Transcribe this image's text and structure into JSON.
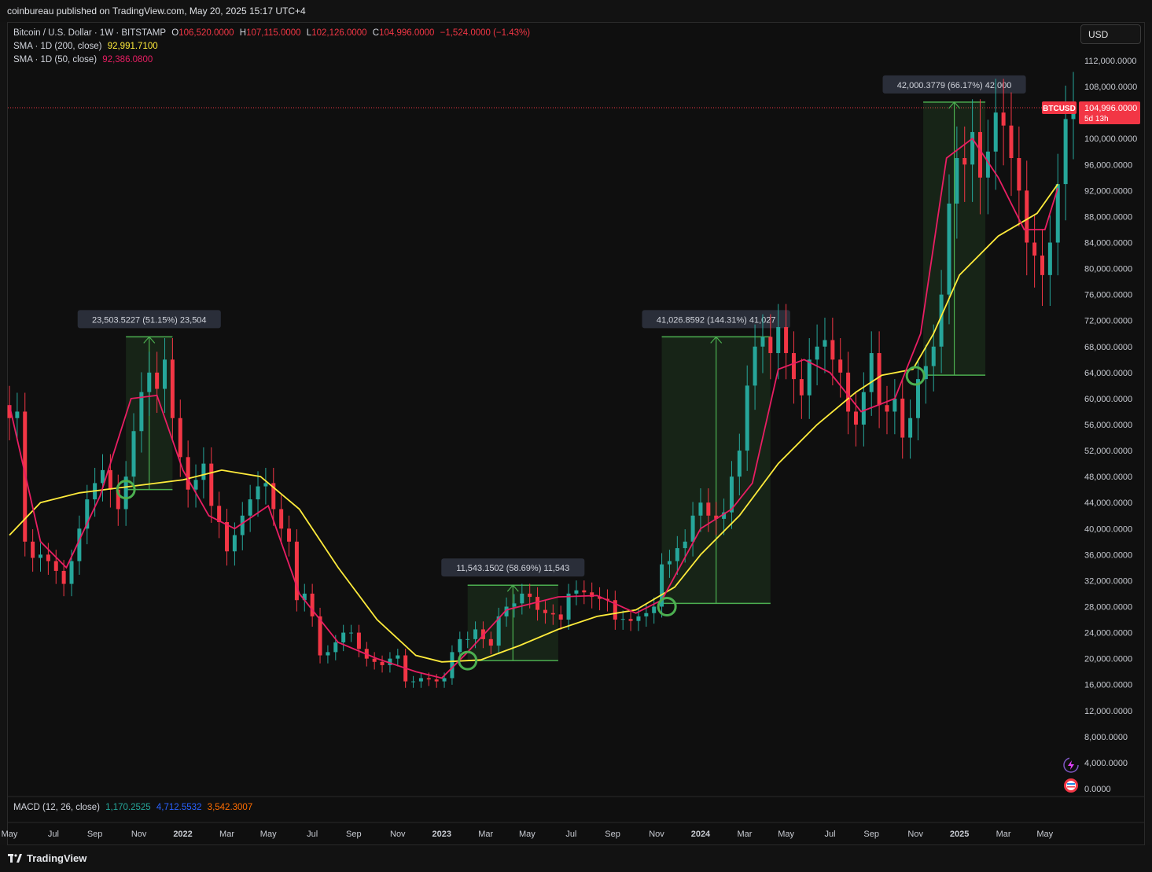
{
  "header": {
    "published": "coinbureau published on TradingView.com, May 20, 2025 15:17 UTC+4"
  },
  "legend": {
    "symbol": "Bitcoin / U.S. Dollar · 1W · BITSTAMP",
    "o_label": "O",
    "o_value": "106,520.0000",
    "h_label": "H",
    "h_value": "107,115.0000",
    "l_label": "L",
    "l_value": "102,126.0000",
    "c_label": "C",
    "c_value": "104,996.0000",
    "change": "−1,524.0000 (−1.43%)",
    "sma200_label": "SMA · 1D (200, close)",
    "sma200_value": "92,991.7100",
    "sma50_label": "SMA · 1D (50, close)",
    "sma50_value": "92,386.0800"
  },
  "macd": {
    "label": "MACD (12, 26, close)",
    "v1": "1,170.2525",
    "v2": "4,712.5532",
    "v3": "3,542.3007"
  },
  "currency_button": "USD",
  "price_tag": {
    "symbol": "BTCUSD",
    "price": "104,996.0000",
    "countdown": "5d 13h"
  },
  "footer": {
    "brand": "TradingView"
  },
  "colors": {
    "up": "#26a69a",
    "down": "#f23645",
    "sma200": "#ffeb3b",
    "sma50": "#e91e63",
    "range_box": "#4caf50",
    "circle": "#4caf50"
  },
  "chart_data": {
    "type": "candlestick",
    "interval": "1W",
    "y_axis_labels": [
      "112,000.0000",
      "108,000.0000",
      "100,000.0000",
      "96,000.0000",
      "92,000.0000",
      "88,000.0000",
      "84,000.0000",
      "80,000.0000",
      "76,000.0000",
      "72,000.0000",
      "68,000.0000",
      "64,000.0000",
      "60,000.0000",
      "56,000.0000",
      "52,000.0000",
      "48,000.0000",
      "44,000.0000",
      "40,000.0000",
      "36,000.0000",
      "32,000.0000",
      "28,000.0000",
      "24,000.0000",
      "20,000.0000",
      "16,000.0000",
      "12,000.0000",
      "8,000.0000",
      "4,000.0000",
      "0.0000"
    ],
    "x_axis_labels": [
      "May",
      "Jul",
      "Sep",
      "Nov",
      "2022",
      "Mar",
      "May",
      "Jul",
      "Sep",
      "Nov",
      "2023",
      "Mar",
      "May",
      "Jul",
      "Sep",
      "Nov",
      "2024",
      "Mar",
      "May",
      "Jul",
      "Sep",
      "Nov",
      "2025",
      "Mar",
      "May"
    ],
    "x_axis_bold": [
      "2022",
      "2023",
      "2024",
      "2025"
    ],
    "range_labels": [
      "23,503.5227 (51.15%) 23,504",
      "11,543.1502 (58.69%) 11,543",
      "41,026.8592 (144.31%) 41,027",
      "42,000.3779 (66.17%) 42,000"
    ],
    "ranges": [
      {
        "from": 46000,
        "to": 69500
      },
      {
        "from": 19700,
        "to": 31300
      },
      {
        "from": 28500,
        "to": 69500
      },
      {
        "from": 63600,
        "to": 105600
      }
    ],
    "sma200_line": [
      [
        2021.33,
        39000
      ],
      [
        2021.45,
        44000
      ],
      [
        2021.6,
        45500
      ],
      [
        2021.8,
        46500
      ],
      [
        2022.0,
        47500
      ],
      [
        2022.15,
        49000
      ],
      [
        2022.3,
        48000
      ],
      [
        2022.45,
        43000
      ],
      [
        2022.6,
        34000
      ],
      [
        2022.75,
        26000
      ],
      [
        2022.9,
        20500
      ],
      [
        2023.0,
        19500
      ],
      [
        2023.15,
        19800
      ],
      [
        2023.3,
        22000
      ],
      [
        2023.45,
        24500
      ],
      [
        2023.6,
        26500
      ],
      [
        2023.75,
        27500
      ],
      [
        2023.9,
        31000
      ],
      [
        2024.0,
        36000
      ],
      [
        2024.15,
        42000
      ],
      [
        2024.3,
        50000
      ],
      [
        2024.45,
        56000
      ],
      [
        2024.6,
        61000
      ],
      [
        2024.7,
        63600
      ],
      [
        2024.82,
        64500
      ],
      [
        2024.9,
        70000
      ],
      [
        2025.0,
        79000
      ],
      [
        2025.15,
        85000
      ],
      [
        2025.3,
        88500
      ],
      [
        2025.38,
        92990
      ]
    ],
    "sma50_line": [
      [
        2021.33,
        59000
      ],
      [
        2021.45,
        38000
      ],
      [
        2021.55,
        34000
      ],
      [
        2021.68,
        45000
      ],
      [
        2021.8,
        60000
      ],
      [
        2021.9,
        60500
      ],
      [
        2022.0,
        49000
      ],
      [
        2022.1,
        42000
      ],
      [
        2022.2,
        40000
      ],
      [
        2022.33,
        43500
      ],
      [
        2022.45,
        30000
      ],
      [
        2022.6,
        22500
      ],
      [
        2022.75,
        20000
      ],
      [
        2022.9,
        18000
      ],
      [
        2023.0,
        17000
      ],
      [
        2023.1,
        21000
      ],
      [
        2023.25,
        27500
      ],
      [
        2023.45,
        29500
      ],
      [
        2023.6,
        29700
      ],
      [
        2023.75,
        27000
      ],
      [
        2023.85,
        29000
      ],
      [
        2024.0,
        40000
      ],
      [
        2024.12,
        43000
      ],
      [
        2024.2,
        47000
      ],
      [
        2024.3,
        64500
      ],
      [
        2024.4,
        66000
      ],
      [
        2024.5,
        64000
      ],
      [
        2024.62,
        58000
      ],
      [
        2024.75,
        60000
      ],
      [
        2024.85,
        70000
      ],
      [
        2024.95,
        97000
      ],
      [
        2025.05,
        100000
      ],
      [
        2025.15,
        94000
      ],
      [
        2025.25,
        86000
      ],
      [
        2025.33,
        86000
      ],
      [
        2025.38,
        92380
      ]
    ],
    "closes": [
      [
        2021.33,
        57000
      ],
      [
        2021.36,
        58000
      ],
      [
        2021.39,
        38000
      ],
      [
        2021.42,
        35500
      ],
      [
        2021.45,
        36000
      ],
      [
        2021.48,
        35000
      ],
      [
        2021.51,
        33500
      ],
      [
        2021.54,
        31500
      ],
      [
        2021.57,
        35000
      ],
      [
        2021.6,
        40000
      ],
      [
        2021.63,
        44500
      ],
      [
        2021.66,
        47000
      ],
      [
        2021.69,
        49000
      ],
      [
        2021.72,
        46000
      ],
      [
        2021.75,
        43000
      ],
      [
        2021.78,
        48000
      ],
      [
        2021.81,
        55000
      ],
      [
        2021.84,
        61000
      ],
      [
        2021.87,
        64000
      ],
      [
        2021.9,
        61500
      ],
      [
        2021.93,
        66000
      ],
      [
        2021.96,
        57000
      ],
      [
        2021.99,
        51000
      ],
      [
        2022.02,
        46000
      ],
      [
        2022.05,
        47500
      ],
      [
        2022.08,
        50000
      ],
      [
        2022.11,
        43500
      ],
      [
        2022.14,
        41000
      ],
      [
        2022.17,
        36500
      ],
      [
        2022.2,
        39000
      ],
      [
        2022.23,
        42000
      ],
      [
        2022.26,
        44500
      ],
      [
        2022.29,
        46500
      ],
      [
        2022.32,
        47000
      ],
      [
        2022.35,
        43000
      ],
      [
        2022.38,
        40000
      ],
      [
        2022.41,
        38000
      ],
      [
        2022.44,
        29000
      ],
      [
        2022.47,
        30000
      ],
      [
        2022.5,
        26500
      ],
      [
        2022.53,
        20500
      ],
      [
        2022.56,
        21000
      ],
      [
        2022.59,
        22500
      ],
      [
        2022.62,
        24000
      ],
      [
        2022.65,
        24000
      ],
      [
        2022.68,
        21500
      ],
      [
        2022.71,
        20000
      ],
      [
        2022.74,
        19500
      ],
      [
        2022.77,
        19000
      ],
      [
        2022.8,
        20000
      ],
      [
        2022.83,
        20500
      ],
      [
        2022.86,
        16500
      ],
      [
        2022.89,
        16500
      ],
      [
        2022.92,
        17000
      ],
      [
        2022.95,
        16800
      ],
      [
        2022.98,
        16500
      ],
      [
        2023.01,
        17000
      ],
      [
        2023.04,
        21000
      ],
      [
        2023.07,
        23000
      ],
      [
        2023.1,
        23000
      ],
      [
        2023.13,
        24500
      ],
      [
        2023.16,
        23000
      ],
      [
        2023.19,
        22000
      ],
      [
        2023.22,
        26500
      ],
      [
        2023.25,
        28000
      ],
      [
        2023.28,
        28500
      ],
      [
        2023.31,
        30000
      ],
      [
        2023.34,
        29500
      ],
      [
        2023.37,
        27500
      ],
      [
        2023.4,
        27000
      ],
      [
        2023.43,
        26800
      ],
      [
        2023.46,
        26000
      ],
      [
        2023.49,
        30000
      ],
      [
        2023.52,
        30500
      ],
      [
        2023.55,
        30200
      ],
      [
        2023.58,
        29500
      ],
      [
        2023.61,
        29200
      ],
      [
        2023.64,
        29000
      ],
      [
        2023.67,
        26000
      ],
      [
        2023.7,
        26100
      ],
      [
        2023.73,
        25800
      ],
      [
        2023.76,
        26500
      ],
      [
        2023.79,
        27000
      ],
      [
        2023.82,
        28000
      ],
      [
        2023.85,
        34500
      ],
      [
        2023.88,
        35000
      ],
      [
        2023.91,
        37000
      ],
      [
        2023.94,
        38000
      ],
      [
        2023.97,
        42000
      ],
      [
        2024.0,
        44000
      ],
      [
        2024.03,
        42000
      ],
      [
        2024.06,
        41500
      ],
      [
        2024.09,
        42500
      ],
      [
        2024.12,
        48000
      ],
      [
        2024.15,
        52000
      ],
      [
        2024.18,
        62000
      ],
      [
        2024.21,
        68000
      ],
      [
        2024.24,
        69500
      ],
      [
        2024.27,
        67000
      ],
      [
        2024.3,
        71000
      ],
      [
        2024.33,
        67000
      ],
      [
        2024.36,
        63000
      ],
      [
        2024.39,
        60500
      ],
      [
        2024.42,
        66000
      ],
      [
        2024.45,
        68000
      ],
      [
        2024.48,
        69000
      ],
      [
        2024.51,
        66000
      ],
      [
        2024.54,
        64000
      ],
      [
        2024.57,
        58000
      ],
      [
        2024.6,
        56000
      ],
      [
        2024.63,
        61000
      ],
      [
        2024.66,
        67000
      ],
      [
        2024.69,
        59000
      ],
      [
        2024.72,
        58000
      ],
      [
        2024.75,
        60000
      ],
      [
        2024.78,
        54000
      ],
      [
        2024.81,
        57000
      ],
      [
        2024.84,
        63000
      ],
      [
        2024.87,
        65000
      ],
      [
        2024.9,
        68000
      ],
      [
        2024.93,
        76000
      ],
      [
        2024.96,
        90000
      ],
      [
        2024.99,
        97000
      ],
      [
        2025.02,
        96000
      ],
      [
        2025.05,
        101000
      ],
      [
        2025.08,
        94000
      ],
      [
        2025.11,
        98000
      ],
      [
        2025.14,
        104000
      ],
      [
        2025.17,
        102000
      ],
      [
        2025.2,
        97000
      ],
      [
        2025.23,
        92000
      ],
      [
        2025.26,
        84000
      ],
      [
        2025.29,
        82000
      ],
      [
        2025.32,
        79000
      ],
      [
        2025.35,
        84000
      ],
      [
        2025.38,
        93000
      ],
      [
        2025.41,
        103000
      ],
      [
        2025.44,
        104996
      ]
    ]
  }
}
